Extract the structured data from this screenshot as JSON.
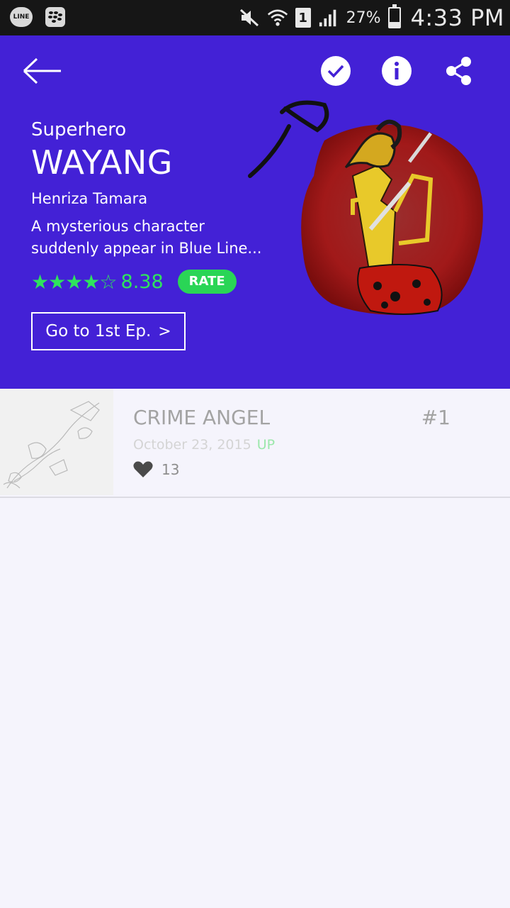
{
  "status_bar": {
    "app_icons": [
      "LINE",
      "BBM"
    ],
    "sim_slot": "1",
    "battery_percent": "27%",
    "battery_level": 0.27,
    "time": "4:33 PM"
  },
  "header": {
    "genre": "Superhero",
    "title": "WAYANG",
    "author": "Henriza Tamara",
    "description": "A mysterious character suddenly appear in Blue Line...",
    "stars": "★★★★☆",
    "rating_value": 4.19,
    "score": "8.38",
    "rate_label": "RATE",
    "goto_label": "Go to 1st Ep.",
    "goto_chevron": ">",
    "colors": {
      "background": "#4321d6",
      "accent_green": "#2fe35d"
    },
    "icons": [
      "back-arrow-icon",
      "check-icon",
      "info-icon",
      "share-icon"
    ]
  },
  "episodes": [
    {
      "title": "CRIME ANGEL",
      "number": "#1",
      "date": "October 23, 2015",
      "badge": "UP",
      "likes": "13"
    }
  ]
}
